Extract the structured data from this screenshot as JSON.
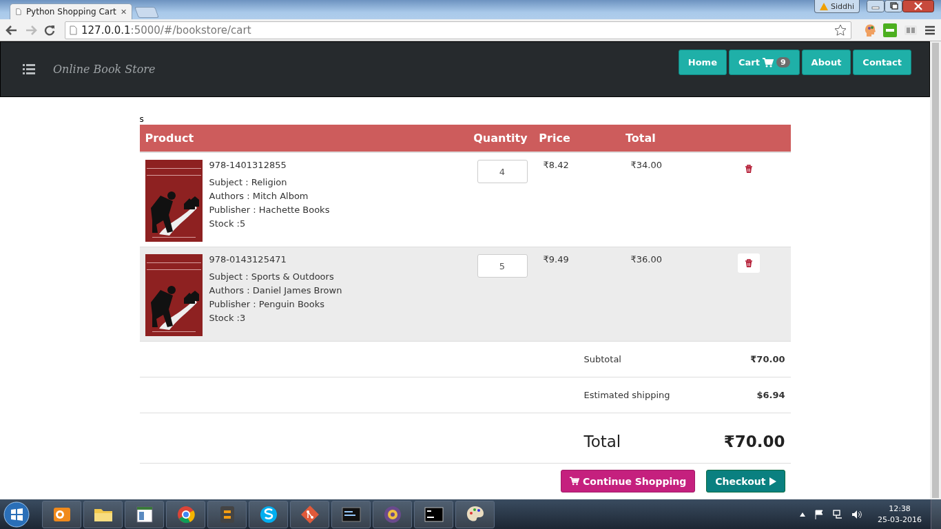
{
  "browser": {
    "tabs": [
      {
        "title": "Python Shopping Cart",
        "selected": true
      }
    ],
    "address": {
      "host": "127.0.0.1",
      "path": ":5000/#/bookstore/cart"
    },
    "profile": "Siddhi"
  },
  "navbar": {
    "brand": "Online Book Store",
    "links": [
      {
        "label": "Home",
        "kind": "plain"
      },
      {
        "label": "Cart",
        "kind": "cart",
        "badge": "9"
      },
      {
        "label": "About",
        "kind": "plain"
      },
      {
        "label": "Contact",
        "kind": "plain"
      }
    ]
  },
  "stray_text": "s",
  "table": {
    "columns": [
      "Product",
      "Quantity",
      "Price",
      "Total"
    ],
    "rows": [
      {
        "isbn": "978-1401312855",
        "details": [
          "Subject : Religion",
          "Authors : Mitch Albom",
          "Publisher : Hachette Books",
          "Stock :5"
        ],
        "quantity": "4",
        "price": "₹8.42",
        "total": "₹34.00",
        "hovered": false
      },
      {
        "isbn": "978-0143125471",
        "details": [
          "Subject : Sports & Outdoors",
          "Authors : Daniel James Brown",
          "Publisher : Penguin Books",
          "Stock :3"
        ],
        "quantity": "5",
        "price": "₹9.49",
        "total": "₹36.00",
        "hovered": true
      }
    ]
  },
  "summary": [
    {
      "label": "Subtotal",
      "value": "₹70.00",
      "kind": "line"
    },
    {
      "label": "Estimated shipping",
      "value": "$6.94",
      "kind": "line"
    },
    {
      "label": "Total",
      "value": "₹70.00",
      "kind": "grand"
    }
  ],
  "buttons": [
    {
      "label": "Continue Shopping",
      "kind": "continue"
    },
    {
      "label": "Checkout",
      "kind": "checkout"
    }
  ],
  "taskbar": {
    "time": "12:38",
    "date": "25-03-2016"
  }
}
